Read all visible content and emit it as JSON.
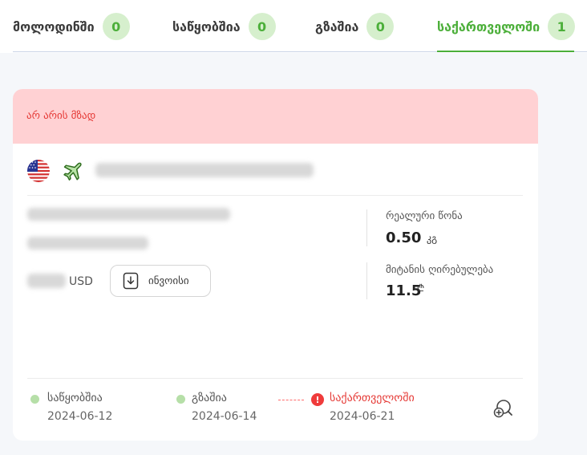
{
  "tabs": [
    {
      "label": "მოლოდინში",
      "count": "0"
    },
    {
      "label": "საწყობშია",
      "count": "0"
    },
    {
      "label": "გზაშია",
      "count": "0"
    },
    {
      "label": "საქართველოში",
      "count": "1"
    }
  ],
  "active_tab": "საქართველოში",
  "card": {
    "status_banner": "არ არის მზად",
    "flag_icon": "usa-flag-icon",
    "transport_icon": "airplane-icon",
    "currency": "USD",
    "invoice_button": "ინვოისი",
    "real_weight": {
      "title": "რეალური წონა",
      "value": "0.50",
      "unit": "კგ"
    },
    "delivery_cost": {
      "title": "მიტანის ღირებულება",
      "value": "11.5",
      "unit": "₾"
    },
    "timeline": [
      {
        "label": "საწყობშია",
        "date": "2024-06-12",
        "state": "done"
      },
      {
        "label": "გზაშია",
        "date": "2024-06-14",
        "state": "done"
      },
      {
        "label": "საქართველოში",
        "date": "2024-06-21",
        "state": "alert"
      }
    ]
  },
  "colors": {
    "accent": "#4caf3a",
    "badge_bg": "#d6efcd",
    "alert": "#e53935",
    "banner_bg": "#ffd1d3"
  }
}
